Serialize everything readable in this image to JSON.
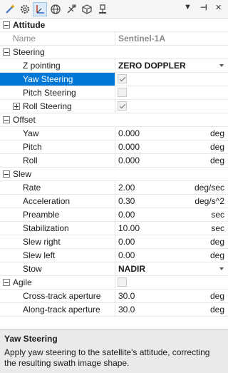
{
  "toolbar": {
    "icons": [
      "wand-icon",
      "gear-icon",
      "axes-icon",
      "globe-icon",
      "satellite-icon",
      "cube-icon",
      "antenna-icon"
    ],
    "menu_arrow": "▼",
    "pin": "⊣",
    "close": "✕"
  },
  "attitude": {
    "category": "Attitude",
    "name_label": "Name",
    "name_value": "Sentinel-1A",
    "steering": {
      "category": "Steering",
      "z_pointing_label": "Z pointing",
      "z_pointing_value": "ZERO DOPPLER",
      "yaw_label": "Yaw Steering",
      "yaw_checked": true,
      "pitch_label": "Pitch Steering",
      "pitch_checked": false,
      "roll_label": "Roll Steering",
      "roll_checked": true
    },
    "offset": {
      "category": "Offset",
      "yaw_label": "Yaw",
      "yaw_value": "0.000",
      "yaw_unit": "deg",
      "pitch_label": "Pitch",
      "pitch_value": "0.000",
      "pitch_unit": "deg",
      "roll_label": "Roll",
      "roll_value": "0.000",
      "roll_unit": "deg"
    },
    "slew": {
      "category": "Slew",
      "rate_label": "Rate",
      "rate_value": "2.00",
      "rate_unit": "deg/sec",
      "accel_label": "Acceleration",
      "accel_value": "0.30",
      "accel_unit": "deg/s^2",
      "preamble_label": "Preamble",
      "preamble_value": "0.00",
      "preamble_unit": "sec",
      "stab_label": "Stabilization",
      "stab_value": "10.00",
      "stab_unit": "sec",
      "right_label": "Slew right",
      "right_value": "0.00",
      "right_unit": "deg",
      "left_label": "Slew left",
      "left_value": "0.00",
      "left_unit": "deg",
      "stow_label": "Stow",
      "stow_value": "NADIR"
    },
    "agile": {
      "category": "Agile",
      "checked": false,
      "cross_label": "Cross-track aperture",
      "cross_value": "30.0",
      "cross_unit": "deg",
      "along_label": "Along-track aperture",
      "along_value": "30.0",
      "along_unit": "deg"
    }
  },
  "help": {
    "title": "Yaw Steering",
    "description": "Apply yaw steering to the satellite's attitude, correcting the resulting swath image shape."
  }
}
